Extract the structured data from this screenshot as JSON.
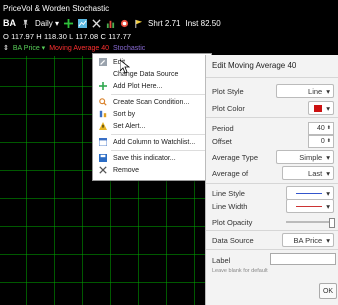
{
  "header": {
    "title": "PriceVol & Worden Stochastic",
    "symbol": "BA",
    "period": "Daily",
    "shrt": "Shrt 2.71",
    "inst": "Inst 82.50",
    "ohlc": "O 117.97  H 118.30  L 117.08  C 117.77",
    "legend_price": "BA Price",
    "legend_ma": "Moving Average 40",
    "legend_stoch": "Stochastic"
  },
  "context_menu": {
    "items": [
      {
        "label": "Edit",
        "icon": "edit-icon"
      },
      {
        "label": "Change Data Source",
        "icon": "none"
      },
      {
        "label": "Add Plot Here...",
        "icon": "add-plot-icon"
      },
      {
        "label": "Create Scan Condition...",
        "icon": "scan-icon"
      },
      {
        "label": "Sort by",
        "icon": "sort-icon"
      },
      {
        "label": "Set Alert...",
        "icon": "alert-icon"
      },
      {
        "label": "Add Column to Watchlist...",
        "icon": "watchlist-icon"
      },
      {
        "label": "Save this indicator...",
        "icon": "save-icon"
      },
      {
        "label": "Remove",
        "icon": "remove-icon"
      }
    ]
  },
  "panel": {
    "title": "Edit Moving Average 40",
    "plot_style_label": "Plot Style",
    "plot_style_value": "Line",
    "plot_color_label": "Plot Color",
    "plot_color": "#cc1111",
    "period_label": "Period",
    "period_value": "40",
    "offset_label": "Offset",
    "offset_value": "0",
    "average_type_label": "Average Type",
    "average_type_value": "Simple",
    "average_of_label": "Average of",
    "average_of_value": "Last",
    "line_style_label": "Line Style",
    "line_width_label": "Line Width",
    "plot_opacity_label": "Plot Opacity",
    "data_source_label": "Data Source",
    "data_source_value": "BA Price",
    "label_label": "Label",
    "label_value": "",
    "label_hint": "Leave blank for default",
    "ok_label": "OK",
    "line_color": "#3355cc"
  }
}
